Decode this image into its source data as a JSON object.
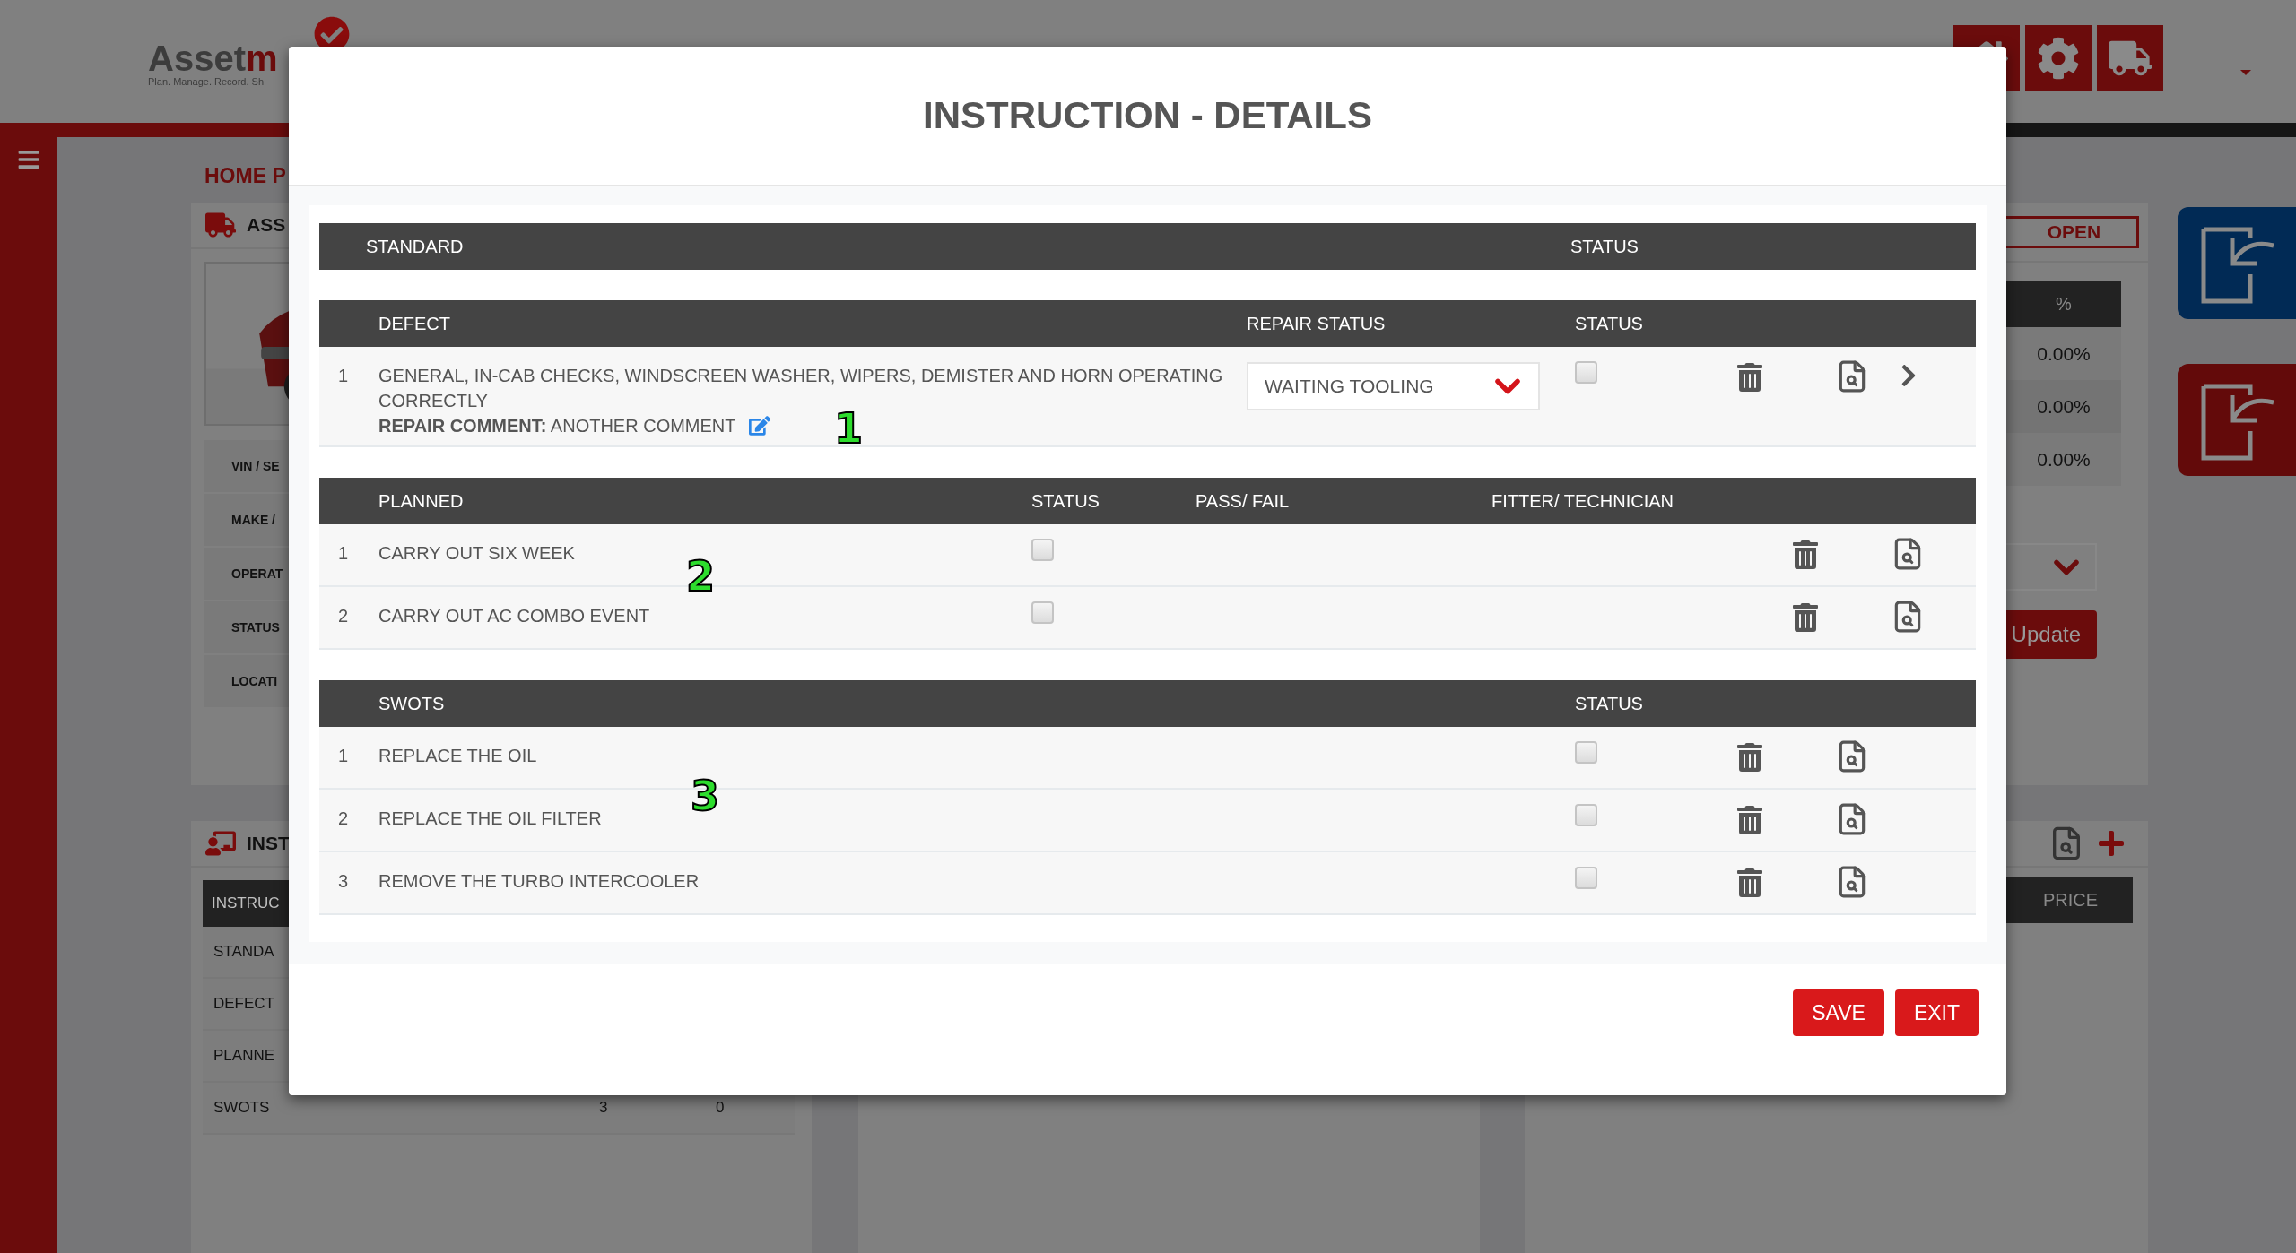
{
  "header": {
    "logo_text": "Asset",
    "logo_accent": "m",
    "tagline": "Plan. Manage. Record. Sh"
  },
  "page_title": "HOME P",
  "asset_panel": {
    "title": "ASS",
    "info_labels": [
      "VIN / SE",
      "MAKE /",
      "OPERAT",
      "STATUS",
      "LOCATI"
    ]
  },
  "instructions_panel": {
    "title": "INST",
    "table_header": "INSTRUC",
    "rows": [
      {
        "label": "STANDA"
      },
      {
        "label": "DEFECT"
      },
      {
        "label": "PLANNE"
      },
      {
        "label": "SWOTS",
        "column_2": "3",
        "column_3": "0"
      }
    ]
  },
  "status_panel": {
    "badge": "OPEN",
    "percent_header": "%",
    "percent_rows": [
      "0.00%",
      "0.00%",
      "0.00%"
    ],
    "update_button": "Update"
  },
  "price_panel": {
    "price_header": "PRICE"
  },
  "modal": {
    "title": "INSTRUCTION - DETAILS",
    "standard_table": {
      "columns": [
        "STANDARD",
        "STATUS"
      ]
    },
    "defect_table": {
      "columns": [
        "DEFECT",
        "REPAIR STATUS",
        "STATUS"
      ],
      "rows": [
        {
          "number": "1",
          "description": "GENERAL, IN-CAB CHECKS, WINDSCREEN WASHER, WIPERS, DEMISTER AND HORN OPERATING CORRECTLY",
          "comment": "**REPAIR COMMENT:** ANOTHER COMMENT",
          "repair_status": "WAITING TOOLING",
          "checked": false
        }
      ]
    },
    "planned_table": {
      "columns": [
        "PLANNED",
        "STATUS",
        "PASS/ FAIL",
        "FITTER/ TECHNICIAN"
      ],
      "rows": [
        {
          "number": "1",
          "description": "CARRY OUT SIX WEEK",
          "checked": false
        },
        {
          "number": "2",
          "description": "CARRY OUT AC COMBO EVENT",
          "checked": false
        }
      ]
    },
    "swots_table": {
      "columns": [
        "SWOTS",
        "STATUS"
      ],
      "rows": [
        {
          "number": "1",
          "description": "REPLACE THE OIL",
          "checked": false
        },
        {
          "number": "2",
          "description": "REPLACE THE OIL FILTER",
          "checked": false
        },
        {
          "number": "3",
          "description": "REMOVE THE TURBO INTERCOOLER",
          "checked": false
        }
      ]
    },
    "buttons": [
      "SAVE",
      "EXIT"
    ]
  },
  "annotations": [
    "1",
    "2",
    "3"
  ]
}
